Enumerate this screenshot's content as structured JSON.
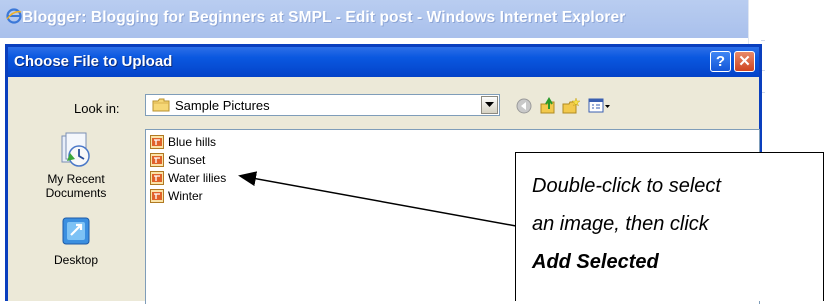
{
  "browser": {
    "window_title": "Blogger: Blogging for Beginners at SMPL - Edit post - Windows Internet Explorer",
    "icon": "ie-logo-icon"
  },
  "dialog": {
    "title": "Choose File to Upload",
    "help_label": "?",
    "close_label": "✕",
    "look_in": {
      "label": "Look in:",
      "value": "Sample Pictures"
    },
    "toolbar_icons": [
      "back-icon",
      "up-folder-icon",
      "new-folder-icon",
      "views-menu-icon"
    ],
    "places": [
      {
        "label_line1": "My Recent",
        "label_line2": "Documents",
        "icon": "recent-documents-icon"
      },
      {
        "label_line1": "Desktop",
        "label_line2": "",
        "icon": "desktop-icon"
      }
    ],
    "files": [
      {
        "name": "Blue hills"
      },
      {
        "name": "Sunset"
      },
      {
        "name": "Water lilies"
      },
      {
        "name": "Winter"
      }
    ]
  },
  "callout": {
    "line1": "Double-click to select",
    "line2": "an image, then click",
    "line3": "Add Selected"
  },
  "colors": {
    "titlebar": "#0a58e0",
    "dialog_bg": "#ece9d8",
    "close_button": "#cf4420"
  }
}
